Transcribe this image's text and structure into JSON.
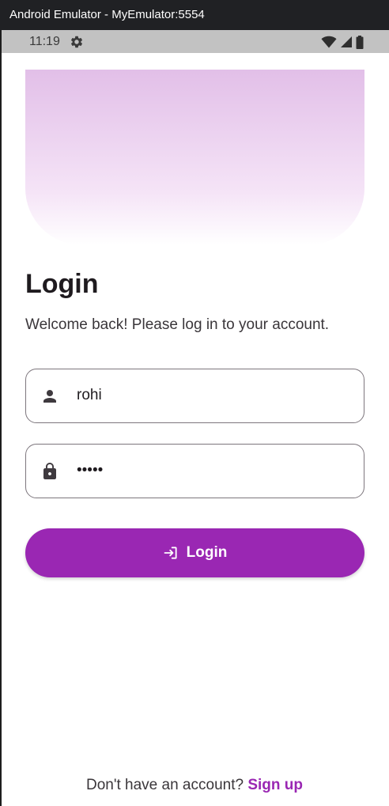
{
  "window": {
    "title": "Android Emulator - MyEmulator:5554"
  },
  "status_bar": {
    "time": "11:19",
    "icons": [
      "settings-gear-icon",
      "wifi-icon",
      "cellular-signal-icon",
      "battery-icon"
    ]
  },
  "login": {
    "heading": "Login",
    "subtitle": "Welcome back! Please log in to your account.",
    "username": {
      "icon": "person-icon",
      "value": "rohi"
    },
    "password": {
      "icon": "lock-icon",
      "value": "•••••"
    },
    "button": {
      "icon": "login-arrow-icon",
      "label": "Login"
    },
    "signup": {
      "prompt": "Don't have an account?",
      "link": "Sign up"
    }
  },
  "colors": {
    "primary": "#9a27b3",
    "hero_top": "#e2bfe8",
    "title_bar": "#202124",
    "status_bar": "#c2c2c2"
  }
}
